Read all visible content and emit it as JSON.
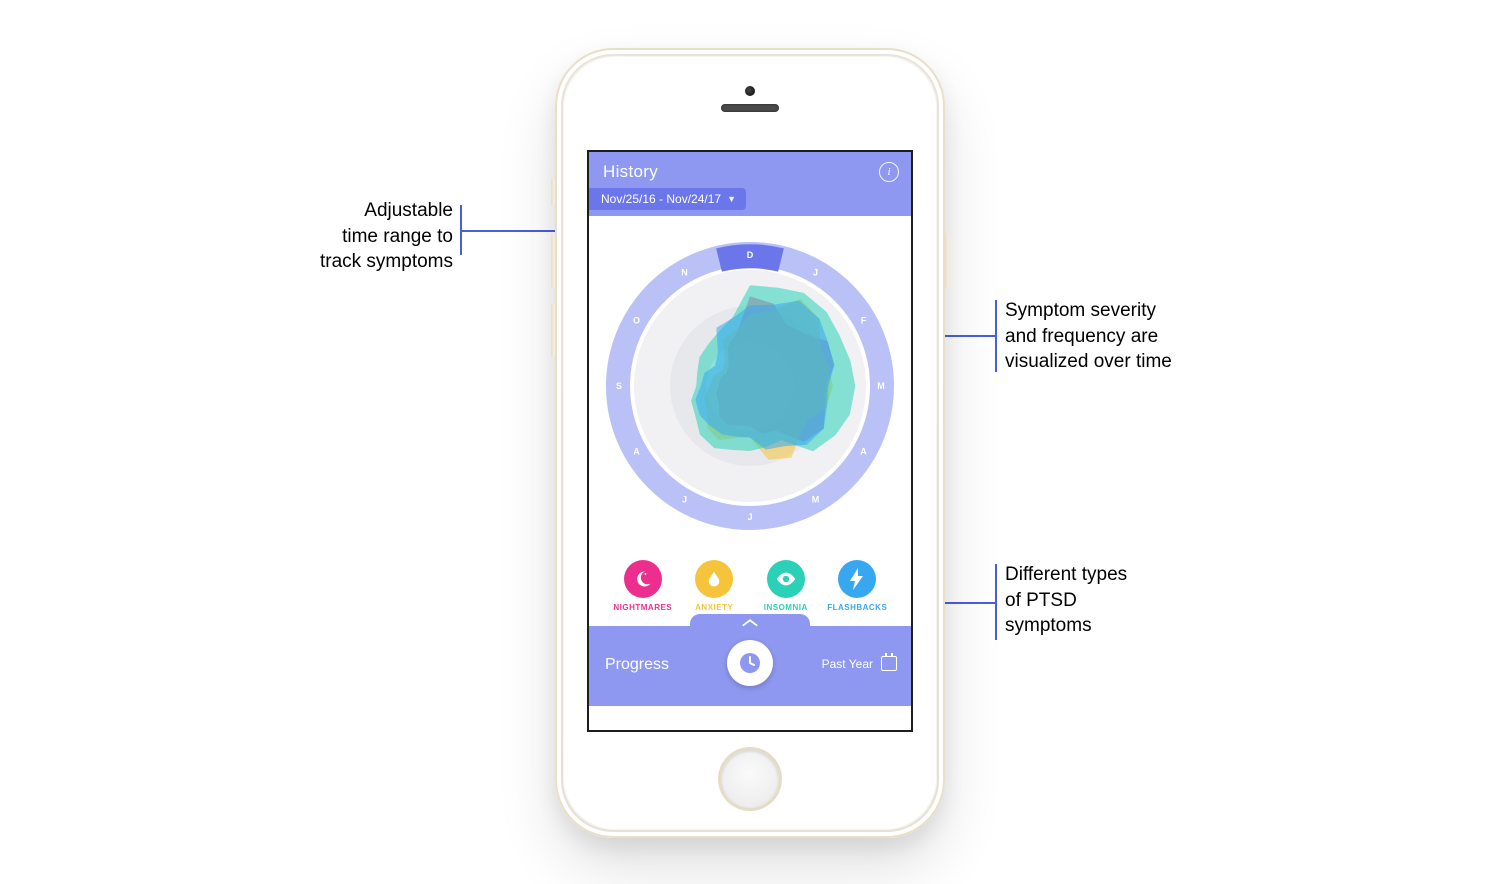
{
  "annotations": {
    "timerange": "Adjustable\ntime range to\ntrack symptoms",
    "severity": "Symptom severity\nand frequency are\nvisualized over time",
    "types": "Different types\nof PTSD\nsymptoms"
  },
  "app": {
    "header_title": "History",
    "info_glyph": "i",
    "date_range": "Nov/25/16 - Nov/24/17"
  },
  "months": [
    "D",
    "J",
    "F",
    "M",
    "A",
    "M",
    "J",
    "J",
    "A",
    "S",
    "O",
    "N"
  ],
  "symptoms": [
    {
      "label": "NIGHTMARES",
      "color": "#ec2f8f",
      "icon": "moon"
    },
    {
      "label": "ANXIETY",
      "color": "#f6c43a",
      "icon": "drop"
    },
    {
      "label": "INSOMNIA",
      "color": "#2ad1b7",
      "icon": "eye"
    },
    {
      "label": "FLASHBACKS",
      "color": "#38a7f2",
      "icon": "bolt"
    }
  ],
  "bottom": {
    "left": "Progress",
    "right": "Past Year"
  },
  "colors": {
    "accent": "#8e98f0",
    "accent_dark": "#6b76ea",
    "anno_line": "#4a5fe0"
  },
  "chart_data": {
    "type": "radar",
    "title": "Symptom severity by month",
    "categories": [
      "D",
      "J",
      "F",
      "M",
      "A",
      "M",
      "J",
      "J",
      "A",
      "S",
      "O",
      "N"
    ],
    "radial_range": [
      0,
      100
    ],
    "note": "Values are approximate readings of radial extent (0=center, 100=outer ring). Series are translucent and overlap.",
    "series": [
      {
        "name": "NIGHTMARES",
        "color": "#ec2f8f",
        "values": [
          80,
          64,
          80,
          68,
          76,
          46,
          36,
          40,
          32,
          28,
          24,
          40
        ]
      },
      {
        "name": "ANXIETY",
        "color": "#f6c43a",
        "values": [
          64,
          90,
          72,
          74,
          60,
          74,
          46,
          56,
          44,
          36,
          28,
          48
        ]
      },
      {
        "name": "INSOMNIA",
        "color": "#2ad1b7",
        "values": [
          90,
          96,
          92,
          94,
          88,
          56,
          58,
          64,
          56,
          48,
          52,
          56
        ]
      },
      {
        "name": "FLASHBACKS",
        "color": "#38a7f2",
        "values": [
          72,
          88,
          80,
          70,
          76,
          62,
          46,
          50,
          52,
          44,
          36,
          60
        ]
      }
    ]
  }
}
